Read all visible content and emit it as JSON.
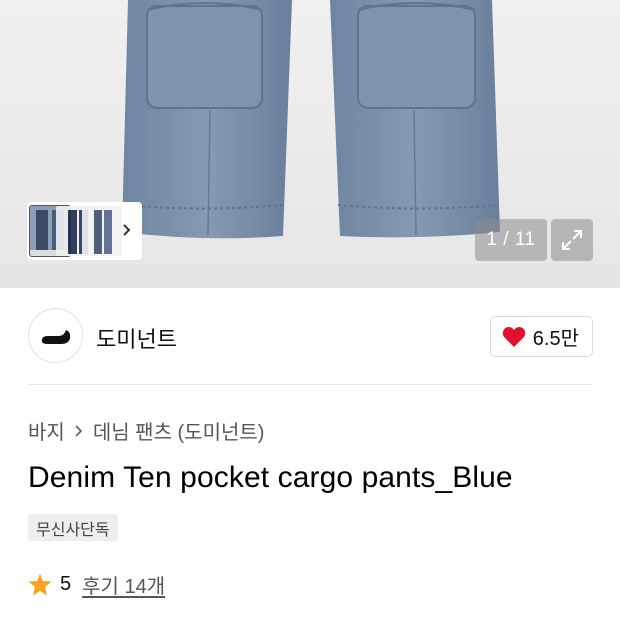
{
  "gallery": {
    "counter": "1 / 11",
    "thumbnail_icons": [
      "thumbnail-1",
      "thumbnail-2",
      "thumbnail-3"
    ],
    "next_icon": "chevron-right-icon",
    "expand_icon": "expand-icon"
  },
  "brand": {
    "name": "도미넌트",
    "logo_icon": "brand-logo-icon",
    "likes": "6.5만",
    "like_icon": "heart-icon",
    "like_color": "#e0102f"
  },
  "breadcrumb": [
    "바지",
    "데님 팬츠 (도미넌트)"
  ],
  "product": {
    "title": "Denim Ten pocket cargo pants_Blue",
    "badge": "무신사단독"
  },
  "rating": {
    "icon": "star-icon",
    "star_color": "#f6a623",
    "score": "5",
    "reviews": "후기 14개"
  }
}
